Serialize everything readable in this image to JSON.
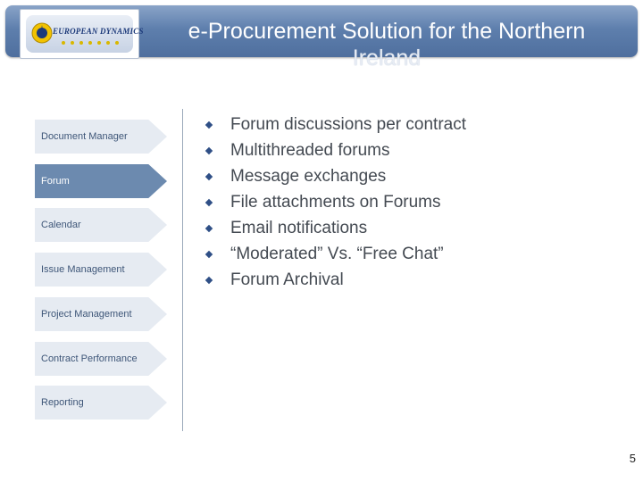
{
  "header": {
    "title_line1": "e-Procurement  Solution for the Northern",
    "title_line2": "Ireland",
    "logo_text": "EUROPEAN DYNAMICS"
  },
  "nav": {
    "items": [
      {
        "label": "Document Manager",
        "active": false
      },
      {
        "label": "Forum",
        "active": true
      },
      {
        "label": "Calendar",
        "active": false
      },
      {
        "label": "Issue Management",
        "active": false
      },
      {
        "label": "Project Management",
        "active": false
      },
      {
        "label": "Contract Performance",
        "active": false
      },
      {
        "label": "Reporting",
        "active": false
      }
    ]
  },
  "content": {
    "bullets": [
      "Forum discussions per contract",
      "Multithreaded forums",
      "Message exchanges",
      "File attachments on Forums",
      "Email notifications",
      "“Moderated” Vs. “Free Chat”",
      "Forum Archival"
    ]
  },
  "footer": {
    "page_number": "5"
  },
  "colors": {
    "header_bar": "#5e7fad",
    "nav_bg": "#e6ebf2",
    "nav_active_bg": "#6c8aaf",
    "bullet": "#2f4f86"
  },
  "icons": {
    "bullet": "diamond-bullet-icon",
    "logo": "european-dynamics-logo"
  }
}
